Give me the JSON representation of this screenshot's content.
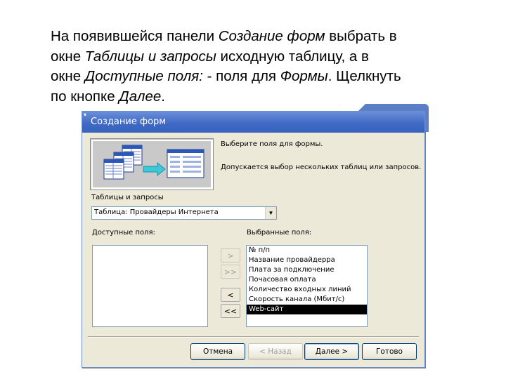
{
  "slide": {
    "line1_a": "На появившейся панели ",
    "line1_b": "Создание форм",
    "line1_c": " выбрать в",
    "line2_a": "окне ",
    "line2_b": "Таблицы и запросы",
    "line2_c": " исходную таблицу, а в",
    "line3_a": "окне ",
    "line3_b": "Доступные поля:",
    "line3_c": " - поля для ",
    "line3_d": "Формы",
    "line3_e": ". Щелкнуть",
    "line4_a": "по кнопке ",
    "line4_b": "Далее",
    "line4_c": "."
  },
  "dialog": {
    "title": "Создание форм",
    "instruction1": "Выберите поля для формы.",
    "instruction2": "Допускается выбор нескольких таблиц или запросов.",
    "tables_label": "Таблицы и запросы",
    "table_select_value": "Таблица: Провайдеры Интернета",
    "available_label": "Доступные поля:",
    "selected_label": "Выбранные поля:",
    "available_fields": [],
    "selected_fields": [
      "№ п/п",
      "Название провайдерра",
      "Плата за подключение",
      "Почасовая оплата",
      "Количество входных линий",
      "Скорость канала (Мбит/с)",
      "Web-сайт"
    ],
    "selected_index": 6,
    "move_buttons": {
      "add_one": ">",
      "add_all": ">>",
      "remove_one": "<",
      "remove_all": "<<"
    },
    "buttons": {
      "cancel": "Отмена",
      "back": "< Назад",
      "next": "Далее >",
      "finish": "Готово"
    }
  },
  "colors": {
    "titlebar": "#3d68c4",
    "dialog_bg": "#ece9d8",
    "selection": "#000000"
  }
}
